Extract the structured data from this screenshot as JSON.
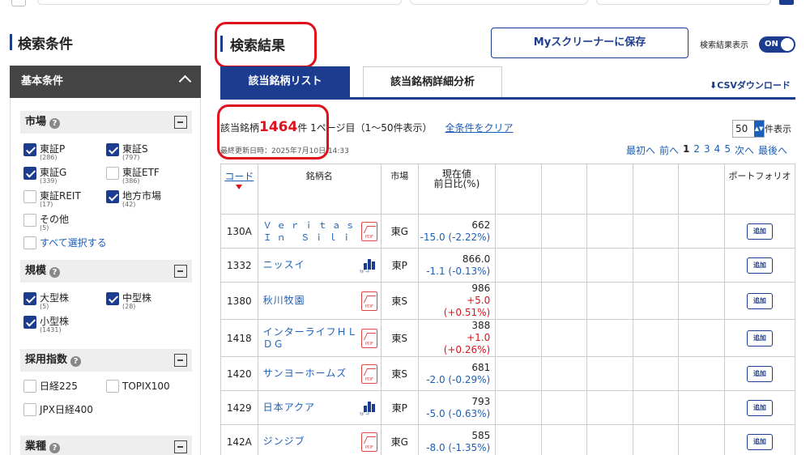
{
  "sidebar": {
    "title": "検索条件",
    "basic_header": "基本条件",
    "sections": {
      "market": {
        "label": "市場",
        "items": [
          {
            "label": "東証P",
            "count": "(286)",
            "checked": true
          },
          {
            "label": "東証S",
            "count": "(797)",
            "checked": true
          },
          {
            "label": "東証G",
            "count": "(339)",
            "checked": true
          },
          {
            "label": "東証ETF",
            "count": "(386)",
            "checked": false
          },
          {
            "label": "東証REIT",
            "count": "(17)",
            "checked": false
          },
          {
            "label": "地方市場",
            "count": "(42)",
            "checked": true
          },
          {
            "label": "その他",
            "count": "(5)",
            "checked": false
          }
        ],
        "select_all": "すべて選択する"
      },
      "size": {
        "label": "規模",
        "items": [
          {
            "label": "大型株",
            "count": "(5)",
            "checked": true
          },
          {
            "label": "中型株",
            "count": "(28)",
            "checked": true
          },
          {
            "label": "小型株",
            "count": "(1431)",
            "checked": true
          }
        ]
      },
      "index": {
        "label": "採用指数",
        "items": [
          {
            "label": "日経225",
            "checked": false
          },
          {
            "label": "TOPIX100",
            "checked": false
          },
          {
            "label": "JPX日経400",
            "checked": false
          }
        ]
      },
      "industry": {
        "label": "業種"
      }
    }
  },
  "main": {
    "title": "検索結果",
    "save_button": "Myスクリーナーに保存",
    "toggle_label": "検索結果表示",
    "toggle_state": "ON",
    "tabs": [
      "該当銘柄リスト",
      "該当銘柄詳細分析"
    ],
    "csv_label": "CSVダウンロード",
    "hit_prefix": "該当銘柄",
    "hit_count": "1464",
    "hit_suffix": "件 1ページ目（1〜50件表示）",
    "clear_link": "全条件をクリア",
    "updated": "最終更新日時：2025年7月10日 14:33",
    "per_page_value": "50",
    "per_page_label": "件表示",
    "pager": {
      "first": "最初へ",
      "prev": "前へ",
      "pages": [
        "1",
        "2",
        "3",
        "4",
        "5"
      ],
      "next": "次へ",
      "last": "最後へ"
    }
  },
  "table": {
    "headers": {
      "code": "コード",
      "name": "銘柄名",
      "market": "市場",
      "price_line1": "現在値",
      "price_line2": "前日比(%)",
      "portfolio": "ポートフォリオ"
    },
    "add_label": "追加",
    "rows": [
      {
        "code": "130A",
        "name": "Ｖｅｒｉｔａｓ Ｉｎ Ｓｉｌｉ",
        "icon": "pdf",
        "market": "東G",
        "price": "662",
        "change": "-15.0 (-2.22%)",
        "dir": "neg"
      },
      {
        "code": "1332",
        "name": "ニッスイ",
        "icon": "report",
        "market": "東P",
        "price": "866.0",
        "change": "-1.1 (-0.13%)",
        "dir": "neg"
      },
      {
        "code": "1380",
        "name": "秋川牧園",
        "icon": "pdf",
        "market": "東S",
        "price": "986",
        "change": "+5.0 (+0.51%)",
        "dir": "pos"
      },
      {
        "code": "1418",
        "name": "インターライフＨＬＤＧ",
        "icon": "pdf",
        "market": "東S",
        "price": "388",
        "change": "+1.0 (+0.26%)",
        "dir": "pos"
      },
      {
        "code": "1420",
        "name": "サンヨーホームズ",
        "icon": "pdf",
        "market": "東S",
        "price": "681",
        "change": "-2.0 (-0.29%)",
        "dir": "neg"
      },
      {
        "code": "1429",
        "name": "日本アクア",
        "icon": "report",
        "market": "東P",
        "price": "793",
        "change": "-5.0 (-0.63%)",
        "dir": "neg"
      },
      {
        "code": "142A",
        "name": "ジンジブ",
        "icon": "pdf",
        "market": "東G",
        "price": "585",
        "change": "-8.0 (-1.35%)",
        "dir": "neg"
      }
    ]
  }
}
